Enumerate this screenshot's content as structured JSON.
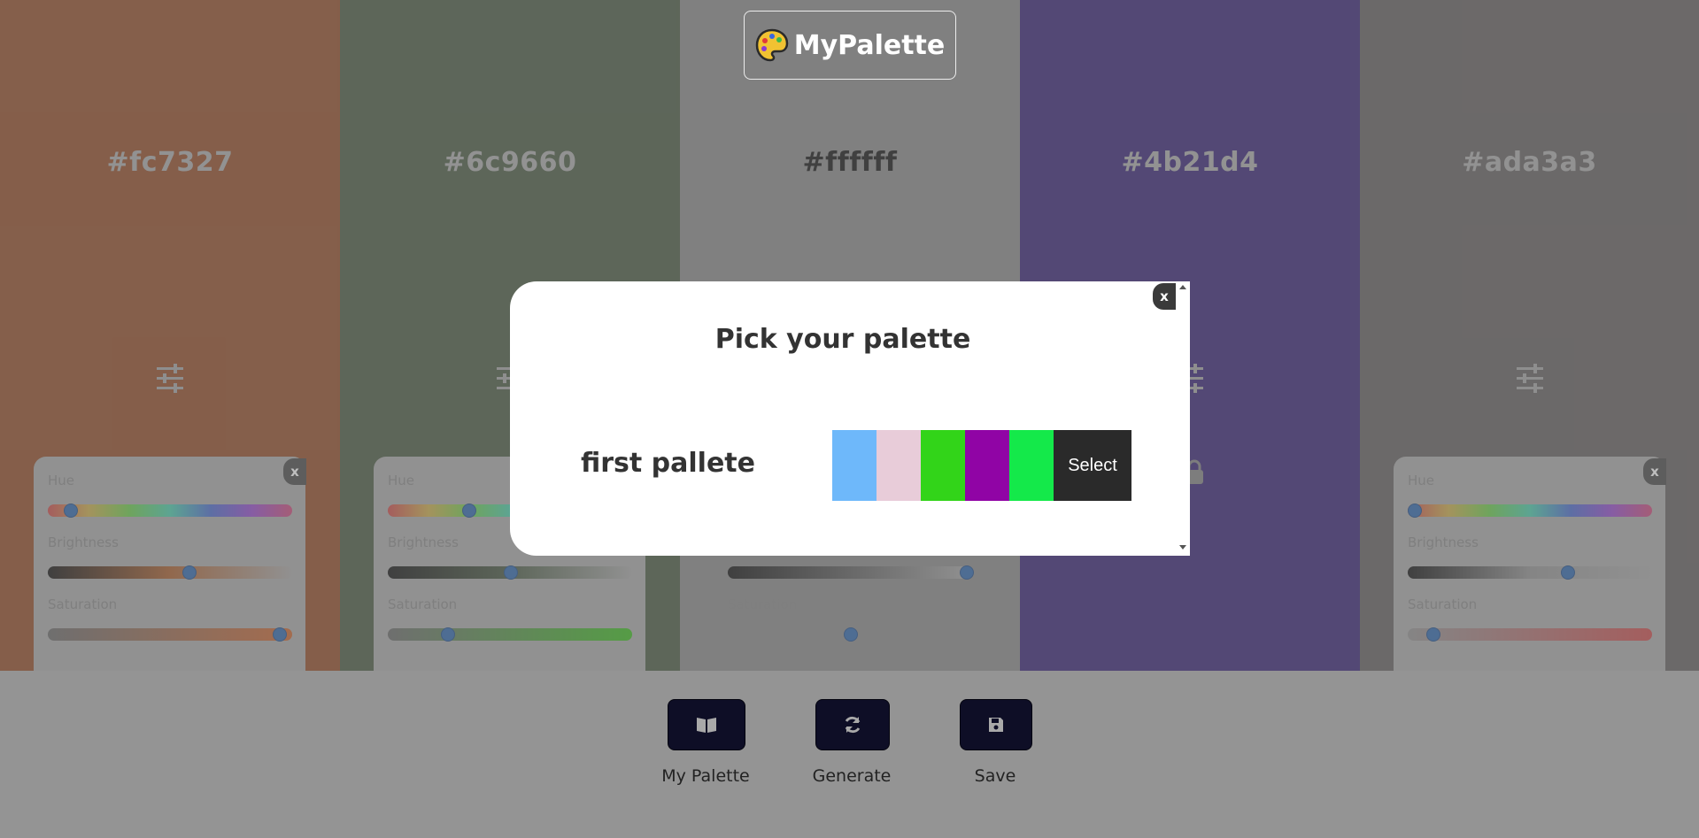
{
  "header": {
    "logo_text": "MyPalette"
  },
  "columns": [
    {
      "hex": "#fc7327",
      "bg": "#8a3d15",
      "text_color": "#a5a5a5"
    },
    {
      "hex": "#6c9660",
      "bg": "#3a4c33",
      "text_color": "#a5a5a5"
    },
    {
      "hex": "#ffffff",
      "bg": "#808080",
      "text_color": "#000000"
    },
    {
      "hex": "#4b21d4",
      "bg": "#26106a",
      "text_color": "#a5a5a5"
    },
    {
      "hex": "#ada3a3",
      "bg": "#575252",
      "text_color": "#a5a5a5"
    }
  ],
  "adjust_panel": {
    "close_label": "x",
    "hue_label": "Hue",
    "brightness_label": "Brightness",
    "saturation_label": "Saturation",
    "levels": [
      {
        "hue": 0.07,
        "brightness": 0.58,
        "saturation": 0.97
      },
      {
        "hue": 0.32,
        "brightness": 0.5,
        "saturation": 0.23
      },
      {
        "hue": null,
        "brightness": 1.0,
        "saturation": 0.5
      },
      null,
      {
        "hue": 0.0,
        "brightness": 0.66,
        "saturation": 0.08
      }
    ]
  },
  "actions": {
    "library_label": "My Palette",
    "generate_label": "Generate",
    "save_label": "Save"
  },
  "modal": {
    "title": "Pick your palette",
    "close_label": "x",
    "palette_name": "first pallete",
    "swatches": [
      "#6eb8fa",
      "#e8ccd9",
      "#32d419",
      "#9004a5",
      "#14e94a"
    ],
    "select_label": "Select"
  }
}
